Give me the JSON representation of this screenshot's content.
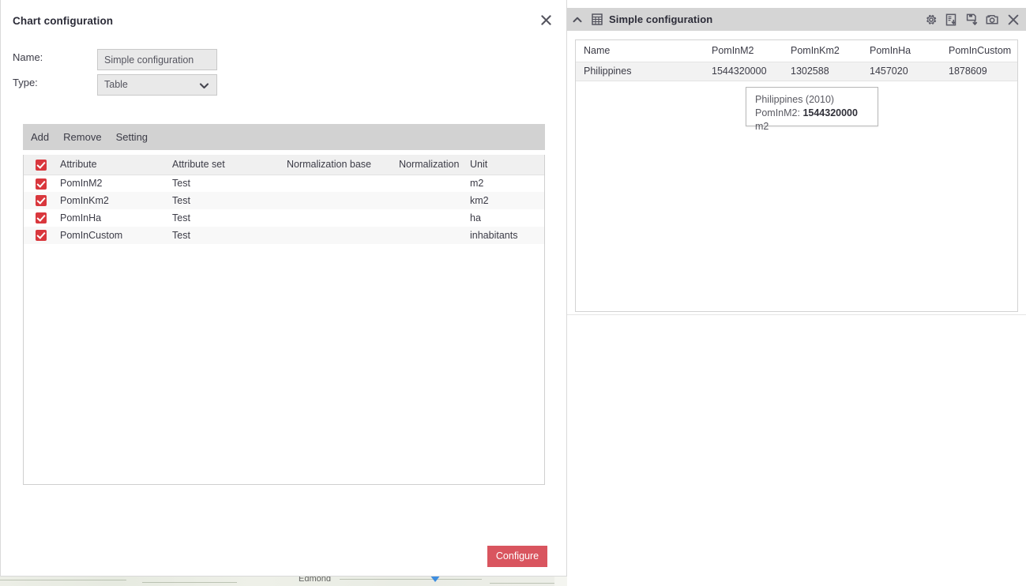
{
  "dialog": {
    "title": "Chart configuration",
    "close_icon": "close-icon",
    "fields": {
      "name_label": "Name:",
      "name_value": "Simple configuration",
      "name_placeholder": "Simple configuration",
      "type_label": "Type:",
      "type_value": "Table",
      "type_options": [
        "Table"
      ],
      "chevron_icon": "chevron-down-icon"
    },
    "toolbar": {
      "add_label": "Add",
      "remove_label": "Remove",
      "setting_label": "Setting"
    },
    "attribute_table": {
      "headers": [
        "Attribute",
        "Attribute set",
        "Normalization base",
        "Normalization",
        "Unit"
      ],
      "header_checked": true,
      "rows": [
        {
          "checked": true,
          "attribute": "PomInM2",
          "attribute_set": "Test",
          "normalization_base": "",
          "normalization": "",
          "unit": "m2"
        },
        {
          "checked": true,
          "attribute": "PomInKm2",
          "attribute_set": "Test",
          "normalization_base": "",
          "normalization": "",
          "unit": "km2"
        },
        {
          "checked": true,
          "attribute": "PomInHa",
          "attribute_set": "Test",
          "normalization_base": "",
          "normalization": "",
          "unit": "ha"
        },
        {
          "checked": true,
          "attribute": "PomInCustom",
          "attribute_set": "Test",
          "normalization_base": "",
          "normalization": "",
          "unit": "inhabitants"
        }
      ]
    },
    "configure_label": "Configure"
  },
  "right_panel": {
    "title": "Simple configuration",
    "collapse_icon": "chevron-up-icon",
    "type_icon": "table-grid-icon",
    "actions": [
      {
        "name": "gear-icon",
        "label": "Settings"
      },
      {
        "name": "export-document-icon",
        "label": "Export"
      },
      {
        "name": "save-disk-icon",
        "label": "Save"
      },
      {
        "name": "camera-icon",
        "label": "Screenshot"
      },
      {
        "name": "close-icon",
        "label": "Close"
      }
    ],
    "data_table": {
      "headers": [
        "Name",
        "PomInM2",
        "PomInKm2",
        "PomInHa",
        "PomInCustom"
      ],
      "rows": [
        {
          "name": "Philippines",
          "PomInM2": "1544320000",
          "PomInKm2": "1302588",
          "PomInHa": "1457020",
          "PomInCustom": "1878609"
        }
      ]
    },
    "tooltip": {
      "line1": "Philippines (2010)",
      "line2_prefix": "PomInM2: ",
      "line2_value": "1544320000",
      "line2_suffix": " m2"
    }
  },
  "background": {
    "map_label": "Edmond"
  },
  "chart_data": {
    "type": "table",
    "title": "Simple configuration",
    "categories": [
      "Philippines"
    ],
    "series": [
      {
        "name": "PomInM2",
        "unit": "m2",
        "values": [
          1544320000
        ]
      },
      {
        "name": "PomInKm2",
        "unit": "km2",
        "values": [
          1302588
        ]
      },
      {
        "name": "PomInHa",
        "unit": "ha",
        "values": [
          1457020
        ]
      },
      {
        "name": "PomInCustom",
        "unit": "inhabitants",
        "values": [
          1878609
        ]
      }
    ],
    "columns": [
      "Name",
      "PomInM2",
      "PomInKm2",
      "PomInHa",
      "PomInCustom"
    ],
    "rows": [
      [
        "Philippines",
        1544320000,
        1302588,
        1457020,
        1878609
      ]
    ],
    "annotations": [
      "Philippines (2010) PomInM2: 1544320000 m2"
    ],
    "xlabel": "",
    "ylabel": "",
    "legend": false,
    "grid": false
  }
}
